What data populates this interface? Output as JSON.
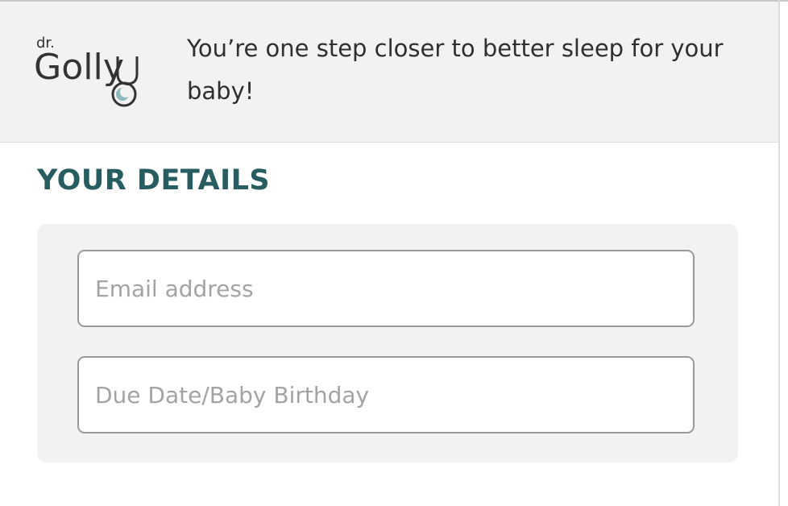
{
  "header": {
    "logo": {
      "text_small": "dr.",
      "text_main": "Golly",
      "icon": "stethoscope-moon-icon",
      "colors": {
        "text": "#333333",
        "moon": "#8fb9bd"
      }
    },
    "tagline": "You’re one step closer to better sleep for your baby!"
  },
  "section": {
    "title": "YOUR DETAILS"
  },
  "form": {
    "email": {
      "value": "",
      "placeholder": "Email address"
    },
    "due_date": {
      "value": "",
      "placeholder": "Due Date/Baby Birthday"
    }
  },
  "colors": {
    "accent": "#275d60",
    "header_bg": "#f2f2f2",
    "card_bg": "#f2f2f2",
    "field_border": "#9a9a9a",
    "placeholder": "#a3a3a3"
  }
}
